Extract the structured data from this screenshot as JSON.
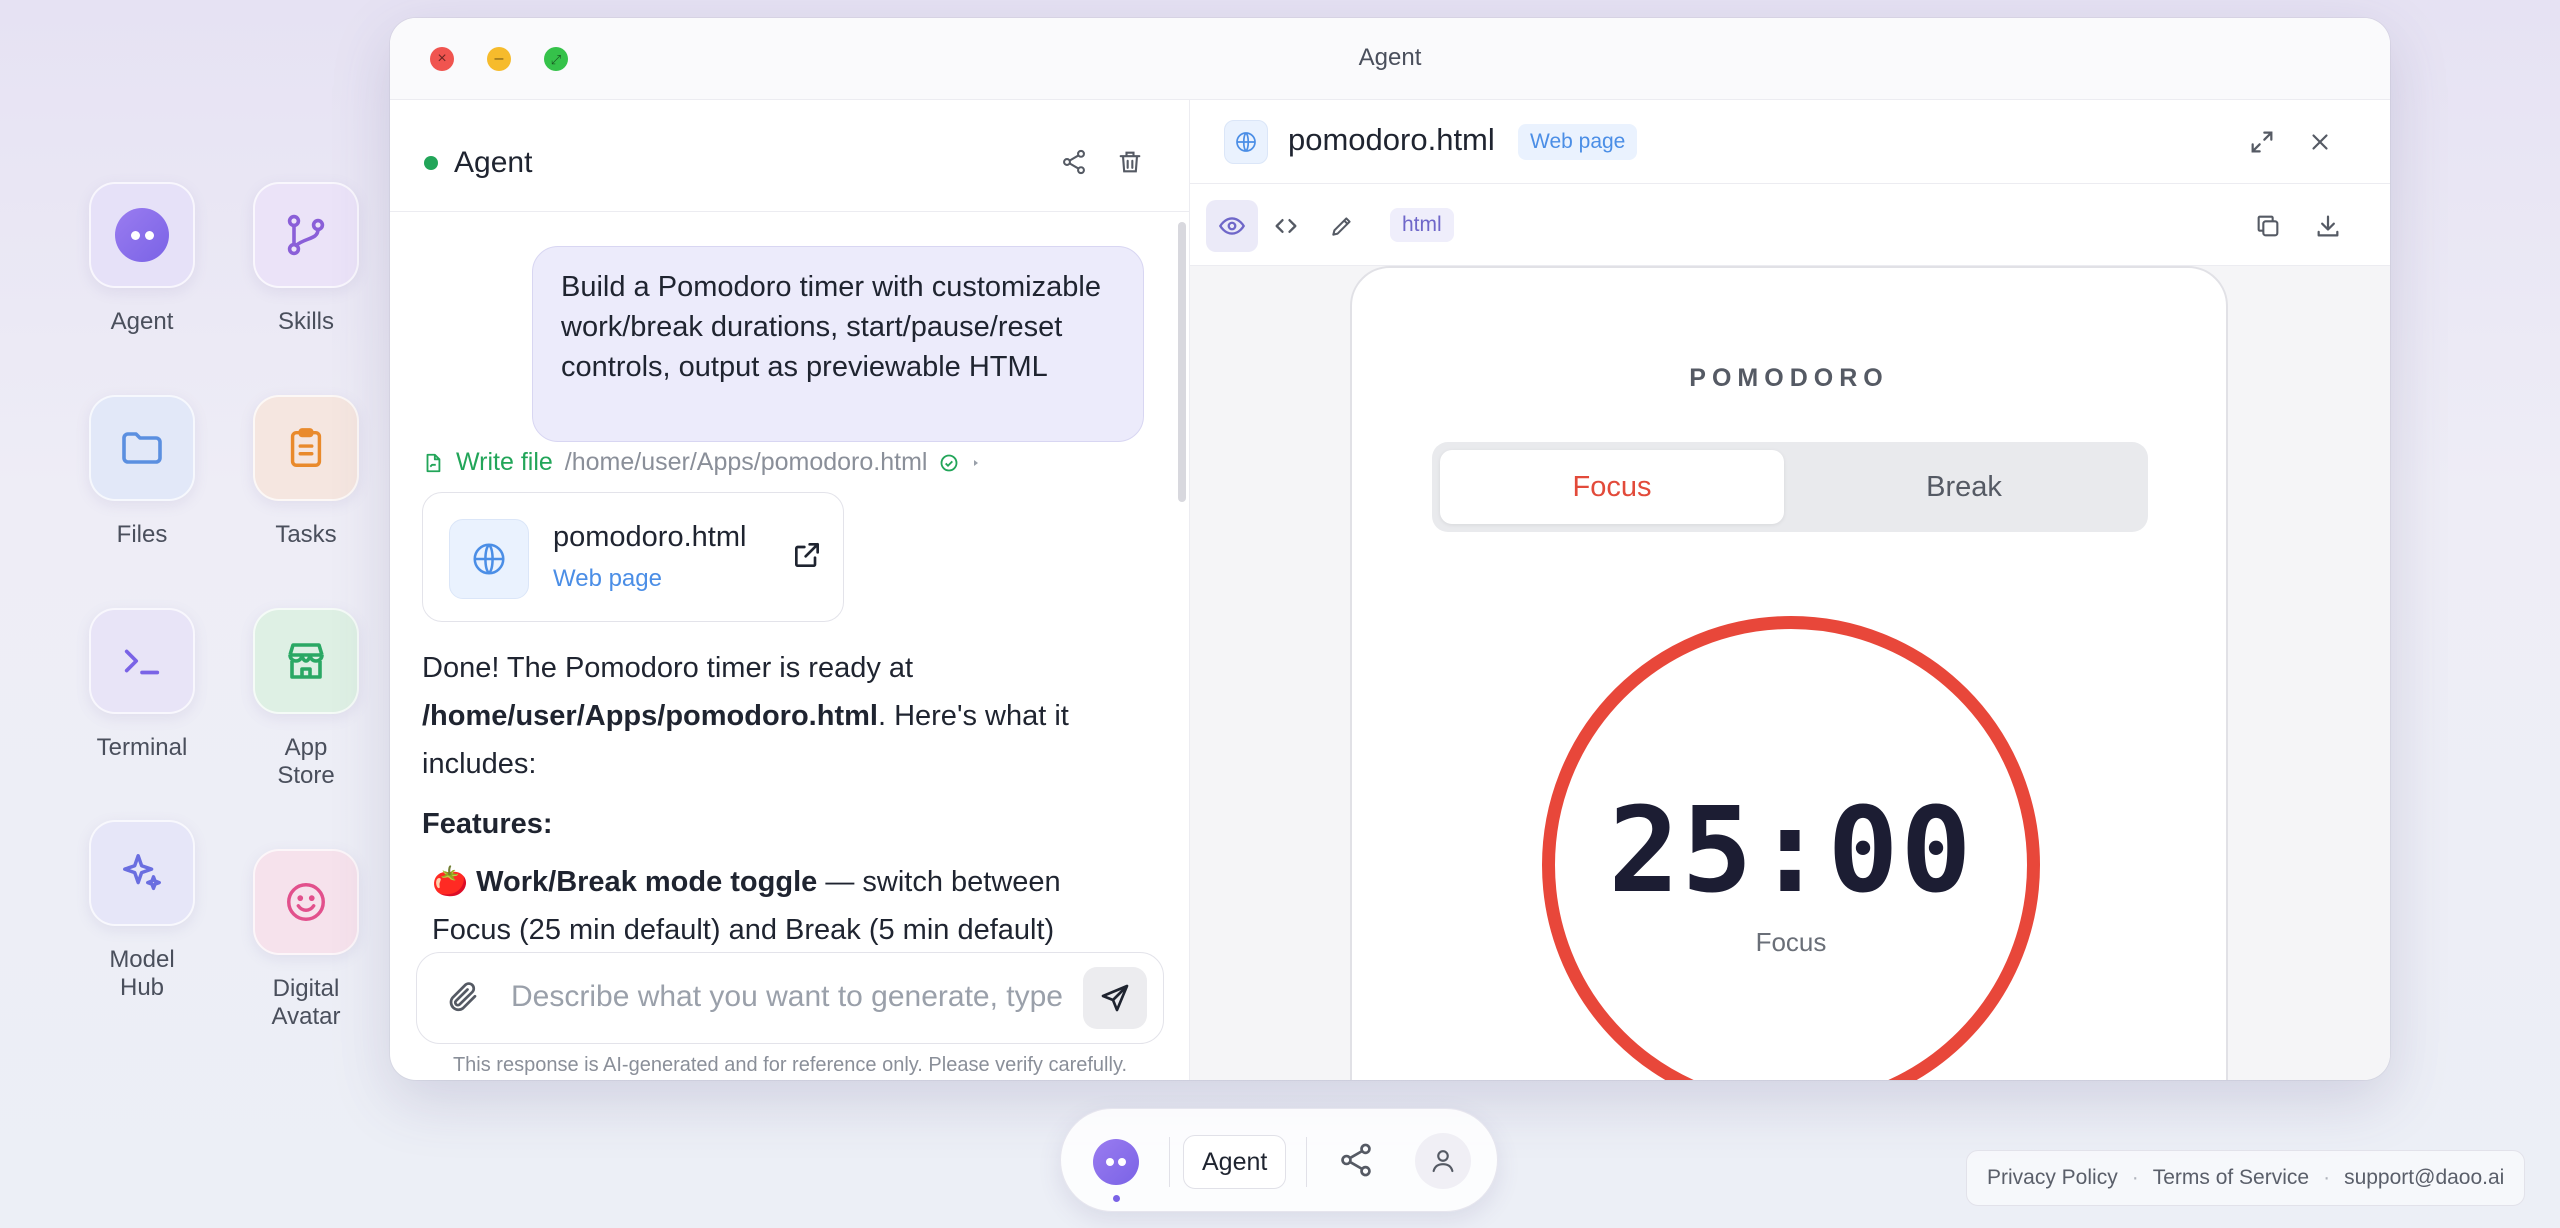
{
  "desktop": {
    "icons": [
      {
        "label": "Agent"
      },
      {
        "label": "Skills"
      },
      {
        "label": "Files"
      },
      {
        "label": "Tasks"
      },
      {
        "label": "Terminal"
      },
      {
        "label": "App Store"
      },
      {
        "label": "Model Hub"
      },
      {
        "label": "Digital Avatar"
      }
    ]
  },
  "window": {
    "title": "Agent"
  },
  "chat": {
    "header_title": "Agent",
    "user_message": "Build a Pomodoro timer with customizable work/break durations, start/pause/reset controls, output as previewable HTML",
    "tool_action": "Write file",
    "tool_path": "/home/user/Apps/pomodoro.html",
    "file_card": {
      "name": "pomodoro.html",
      "type": "Web page"
    },
    "reply_intro_1": "Done! The Pomodoro timer is ready at ",
    "reply_path": "/home/user/Apps/pomodoro.html",
    "reply_intro_2": ". Here's what it includes:",
    "features_heading": "Features:",
    "feature_1_emoji": "🍅",
    "feature_1_bold": "Work/Break mode toggle",
    "feature_1_text": " — switch between Focus (25 min default) and Break (5 min default)",
    "input_placeholder": "Describe what you want to generate, type / for skills",
    "disclaimer": "This response is AI-generated and for reference only. Please verify carefully."
  },
  "preview": {
    "file_name": "pomodoro.html",
    "file_type": "Web page",
    "format_tag": "html",
    "app": {
      "title": "POMODORO",
      "mode_focus": "Focus",
      "mode_break": "Break",
      "time": "25:00",
      "current_mode": "Focus"
    }
  },
  "dock": {
    "agent_label": "Agent"
  },
  "footer": {
    "privacy": "Privacy Policy",
    "terms": "Terms of Service",
    "support": "support@daoo.ai"
  },
  "colors": {
    "accent_purple": "#7a63e6",
    "focus_red": "#e8473a",
    "link_blue": "#4b8ee6",
    "success_green": "#22a559"
  }
}
